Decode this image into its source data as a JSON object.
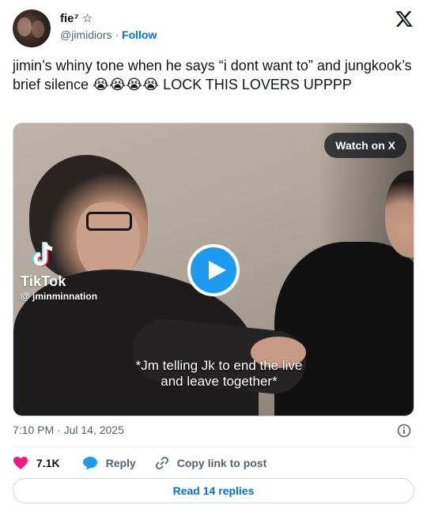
{
  "author": {
    "display_name": "fie⁷ ☆",
    "handle": "@jimidiors",
    "separator": "·",
    "follow_label": "Follow"
  },
  "tweet": {
    "text": "jimin’s whiny tone when he says “i dont want to” and jungkook’s brief silence 😭😭😭😭 LOCK THIS LOVERS UPPPP"
  },
  "media": {
    "watch_label": "Watch on X",
    "tiktok_brand": "TikTok",
    "tiktok_user": "@ jminminnation",
    "caption_line1": "*Jm telling Jk to end the live",
    "caption_line2": "and leave together*"
  },
  "meta": {
    "timestamp": "7:10 PM · Jul 14, 2025"
  },
  "actions": {
    "likes": "7.1K",
    "reply_label": "Reply",
    "copy_link_label": "Copy link to post"
  },
  "footer": {
    "read_replies_label": "Read 14 replies"
  },
  "colors": {
    "accent": "#1d9bf0",
    "link": "#006fd6",
    "like": "#f91880",
    "muted": "#536471"
  }
}
